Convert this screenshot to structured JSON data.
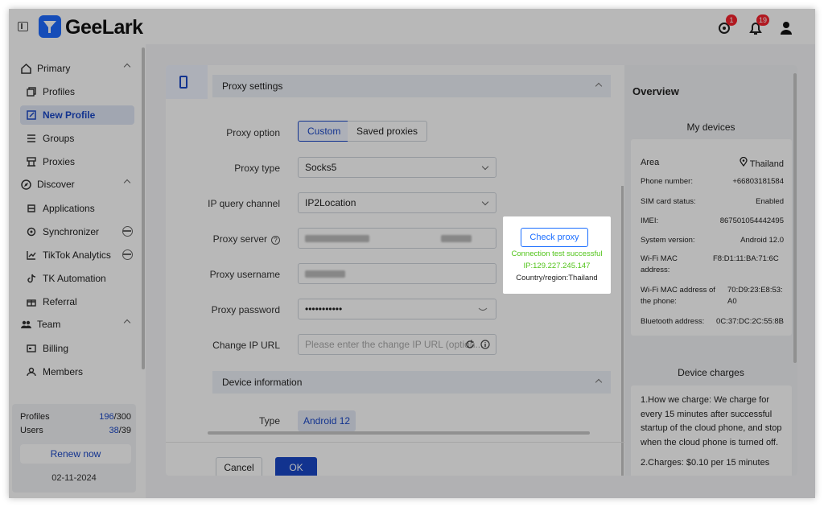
{
  "app": {
    "brand": "GeeLark",
    "notifications": {
      "alert_count": "1",
      "bell_count": "19"
    }
  },
  "sidebar": {
    "sections": [
      {
        "label": "Primary",
        "icon": "home-icon"
      },
      {
        "label": "Discover",
        "icon": "compass-icon"
      },
      {
        "label": "Team",
        "icon": "team-icon"
      }
    ],
    "primary_items": [
      {
        "label": "Profiles",
        "icon": "copy-icon"
      },
      {
        "label": "New Profile",
        "icon": "edit-icon"
      },
      {
        "label": "Groups",
        "icon": "list-icon"
      },
      {
        "label": "Proxies",
        "icon": "network-icon"
      }
    ],
    "discover_items": [
      {
        "label": "Applications",
        "icon": "apps-icon"
      },
      {
        "label": "Synchronizer",
        "icon": "sync-icon"
      },
      {
        "label": "TikTok Analytics",
        "icon": "chart-icon"
      },
      {
        "label": "TK Automation",
        "icon": "tiktok-icon"
      },
      {
        "label": "Referral",
        "icon": "gift-icon"
      }
    ],
    "team_items": [
      {
        "label": "Billing",
        "icon": "billing-icon"
      },
      {
        "label": "Members",
        "icon": "members-icon"
      }
    ],
    "footer": {
      "profiles_label": "Profiles",
      "profiles_used": "196",
      "profiles_total": "/300",
      "users_label": "Users",
      "users_used": "38",
      "users_total": "/39",
      "renew_label": "Renew now",
      "date": "02-11-2024"
    }
  },
  "form": {
    "proxy_section_title": "Proxy settings",
    "device_section_title": "Device information",
    "proxy_option_label": "Proxy option",
    "proxy_option_custom": "Custom",
    "proxy_option_saved": "Saved proxies",
    "proxy_type_label": "Proxy type",
    "proxy_type_value": "Socks5",
    "ip_query_label": "IP query channel",
    "ip_query_value": "IP2Location",
    "proxy_server_label": "Proxy server",
    "proxy_username_label": "Proxy username",
    "proxy_password_label": "Proxy password",
    "proxy_password_value": "•••••••••••",
    "change_ip_label": "Change IP URL",
    "change_ip_placeholder": "Please enter the change IP URL (option...",
    "type_label": "Type",
    "type_value": "Android 12",
    "cancel_label": "Cancel",
    "ok_label": "OK"
  },
  "check_proxy": {
    "button_label": "Check proxy",
    "status": "Connection test successful",
    "ip": "IP:129.227.245.147",
    "region": "Country/region:Thailand",
    "success_color": "#52c41a"
  },
  "overview": {
    "title": "Overview",
    "my_devices": "My devices",
    "area_label": "Area",
    "area_value": "Thailand",
    "rows": [
      {
        "k": "Phone number:",
        "v": "+66803181584"
      },
      {
        "k": "SIM card status:",
        "v": "Enabled"
      },
      {
        "k": "IMEI:",
        "v": "867501054442495"
      },
      {
        "k": "System version:",
        "v": "Android 12.0"
      },
      {
        "k": "Wi-Fi MAC address:",
        "v": "F8:D1:11:BA:71:6C"
      },
      {
        "k": "Wi-Fi MAC address of the phone:",
        "v": "70:D9:23:E8:53:A0"
      },
      {
        "k": "Bluetooth address:",
        "v": "0C:37:DC:2C:55:8B"
      }
    ],
    "device_charges": "Device charges",
    "charge_text_1": "1.How we charge: We charge for every 15 minutes after successful startup of the cloud phone, and stop when the cloud phone is turned off.",
    "charge_text_2": "2.Charges: $0.10 per 15 minutes"
  }
}
